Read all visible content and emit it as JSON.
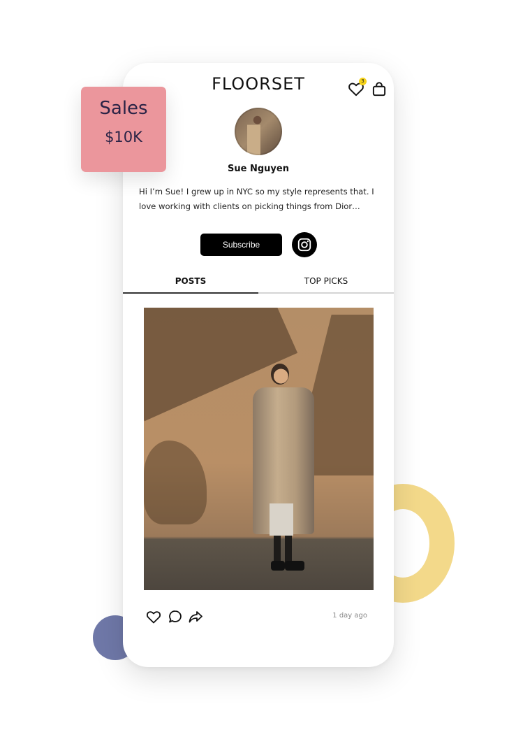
{
  "header": {
    "brand": "FLOORSET",
    "wishlist_count": "3"
  },
  "profile": {
    "name": "Sue Nguyen",
    "bio": "Hi I’m Sue! I grew up in NYC so my style represents that. I love working with clients on picking things from Dior…"
  },
  "actions_bar": {
    "subscribe_label": "Subscribe",
    "instagram_icon": "instagram-icon"
  },
  "tabs": [
    {
      "label": "POSTS",
      "active": true
    },
    {
      "label": "TOP PICKS",
      "active": false
    }
  ],
  "post": {
    "time_label": "1 day ago",
    "icons": [
      "heart-icon",
      "comment-icon",
      "share-icon"
    ]
  },
  "sales_card": {
    "title": "Sales",
    "value": "$10K"
  },
  "colors": {
    "sales_card_bg": "#eb969c",
    "sales_text": "#2a2346",
    "ring": "#f3d98a",
    "dot": "#6f78a8",
    "badge": "#f6d31a",
    "button": "#000000"
  }
}
